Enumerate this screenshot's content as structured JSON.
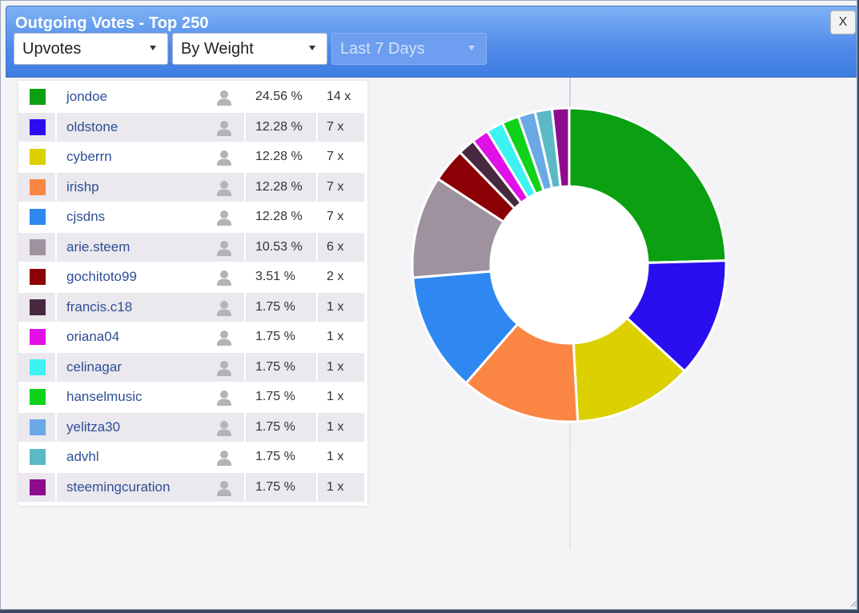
{
  "dialog": {
    "title": "Outgoing Votes - Top 250",
    "close_label": "X"
  },
  "filters": [
    {
      "name": "vote-type-select",
      "value": "Upvotes",
      "disabled": false
    },
    {
      "name": "sort-select",
      "value": "By Weight",
      "disabled": false
    },
    {
      "name": "period-select",
      "value": "Last 7 Days",
      "disabled": true
    }
  ],
  "icons": {
    "user": "user-silhouette-icon",
    "close": "close-icon",
    "caret": "caret-down-icon"
  },
  "votes": [
    {
      "user": "jondoe",
      "percent": "24.56 %",
      "count": "14 x",
      "value": 24.56,
      "color": "#0aa012"
    },
    {
      "user": "oldstone",
      "percent": "12.28 %",
      "count": "7 x",
      "value": 12.28,
      "color": "#2a0ef0"
    },
    {
      "user": "cyberrn",
      "percent": "12.28 %",
      "count": "7 x",
      "value": 12.28,
      "color": "#dcd000"
    },
    {
      "user": "irishp",
      "percent": "12.28 %",
      "count": "7 x",
      "value": 12.28,
      "color": "#fb8644"
    },
    {
      "user": "cjsdns",
      "percent": "12.28 %",
      "count": "7 x",
      "value": 12.28,
      "color": "#2f88f2"
    },
    {
      "user": "arie.steem",
      "percent": "10.53 %",
      "count": "6 x",
      "value": 10.53,
      "color": "#9d929e"
    },
    {
      "user": "gochitoto99",
      "percent": "3.51 %",
      "count": "2 x",
      "value": 3.51,
      "color": "#8b0005"
    },
    {
      "user": "francis.c18",
      "percent": "1.75 %",
      "count": "1 x",
      "value": 1.75,
      "color": "#47293f"
    },
    {
      "user": "oriana04",
      "percent": "1.75 %",
      "count": "1 x",
      "value": 1.75,
      "color": "#e010e6"
    },
    {
      "user": "celinagar",
      "percent": "1.75 %",
      "count": "1 x",
      "value": 1.75,
      "color": "#3cf3f2"
    },
    {
      "user": "hanselmusic",
      "percent": "1.75 %",
      "count": "1 x",
      "value": 1.75,
      "color": "#10d21a"
    },
    {
      "user": "yelitza30",
      "percent": "1.75 %",
      "count": "1 x",
      "value": 1.75,
      "color": "#6ba9e6"
    },
    {
      "user": "advhl",
      "percent": "1.75 %",
      "count": "1 x",
      "value": 1.75,
      "color": "#5bb9c6"
    },
    {
      "user": "steemingcuration",
      "percent": "1.75 %",
      "count": "1 x",
      "value": 1.75,
      "color": "#8e0c8d"
    }
  ]
}
